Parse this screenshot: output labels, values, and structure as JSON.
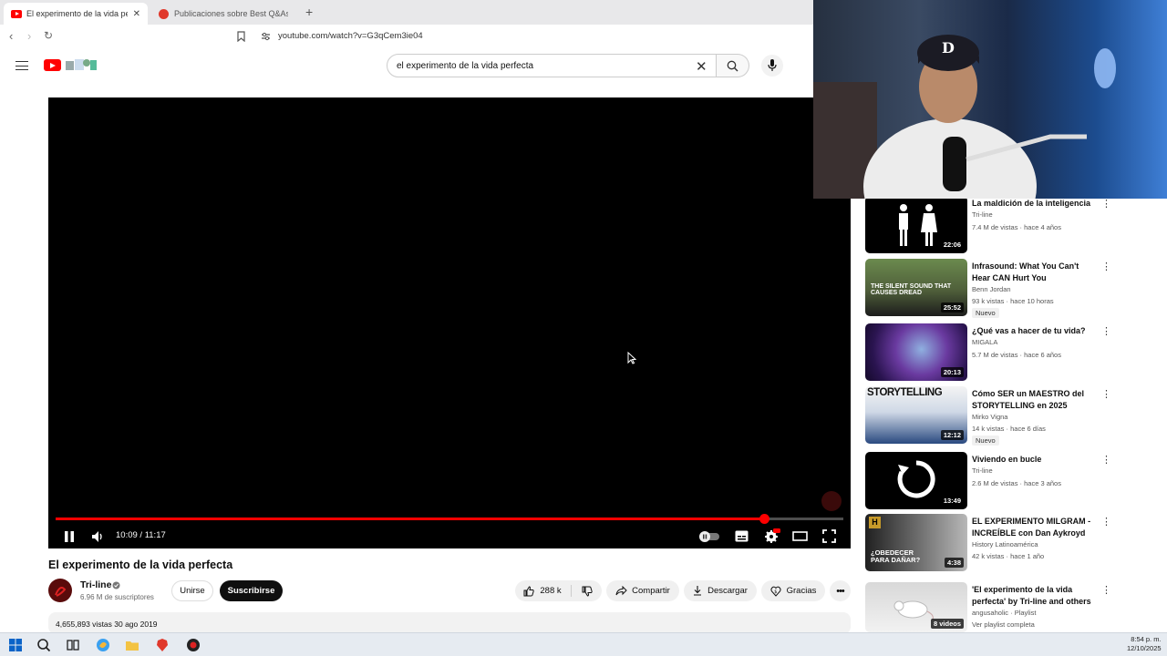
{
  "browser": {
    "tabs": [
      {
        "title": "El experimento de la vida per",
        "active": true
      },
      {
        "title": "Publicaciones sobre Best Q&As & St",
        "active": false
      }
    ],
    "url": "youtube.com/watch?v=G3qCem3ie04"
  },
  "search": {
    "query": "el experimento de la vida perfecta"
  },
  "player": {
    "time_display": "10:09 / 11:17",
    "progress_fraction": 0.899
  },
  "video": {
    "title": "El experimento de la vida perfecta",
    "channel": "Tri-line",
    "subscribers": "6.96 M de suscriptores",
    "join_label": "Unirse",
    "subscribe_label": "Suscribirse",
    "likes": "288 k",
    "share_label": "Compartir",
    "download_label": "Descargar",
    "thanks_label": "Gracias",
    "description_meta": "4,655,893 vistas  30 ago 2019"
  },
  "sidebar": {
    "items": [
      {
        "title": "La maldición de la inteligencia",
        "channel": "Tri-line",
        "meta": "7.4 M de vistas · hace 4 años",
        "duration": "22:06",
        "badge": ""
      },
      {
        "title": "Infrasound: What You Can't Hear CAN Hurt You",
        "channel": "Benn Jordan",
        "meta": "93 k vistas · hace 10 horas",
        "duration": "25:52",
        "badge": "Nuevo"
      },
      {
        "title": "¿Qué vas a hacer de tu vida?",
        "channel": "MIGALA",
        "meta": "5.7 M de vistas · hace 6 años",
        "duration": "20:13",
        "badge": ""
      },
      {
        "title": "Cómo SER un MAESTRO del STORYTELLING en 2025",
        "channel": "Mirko Vigna",
        "meta": "14 k vistas · hace 6 días",
        "duration": "12:12",
        "badge": "Nuevo"
      },
      {
        "title": "Viviendo en bucle",
        "channel": "Tri-line",
        "meta": "2.6 M de vistas · hace 3 años",
        "duration": "13:49",
        "badge": ""
      },
      {
        "title": "EL EXPERIMENTO MILGRAM - INCREÍBLE con Dan Aykroyd",
        "channel": "History Latinoamérica",
        "meta": "42 k vistas · hace 1 año",
        "duration": "4:38",
        "badge": ""
      },
      {
        "title": "'El experimento de la vida perfecta' by Tri-line and others",
        "channel": "angusaholic · Playlist",
        "meta": "Ver playlist completa",
        "duration": "8 videos",
        "badge": ""
      }
    ],
    "thumb_texts": [
      "THE SILENT SOUND THAT CAUSES DREAD",
      "STORYTELLING",
      "¿OBEDECER PARA DAÑAR?",
      "H"
    ]
  },
  "taskbar": {
    "time": "8:54 p. m.",
    "date": "12/10/2025"
  },
  "colors": {
    "brand": "#ff0000",
    "progress": "#ff0000"
  }
}
